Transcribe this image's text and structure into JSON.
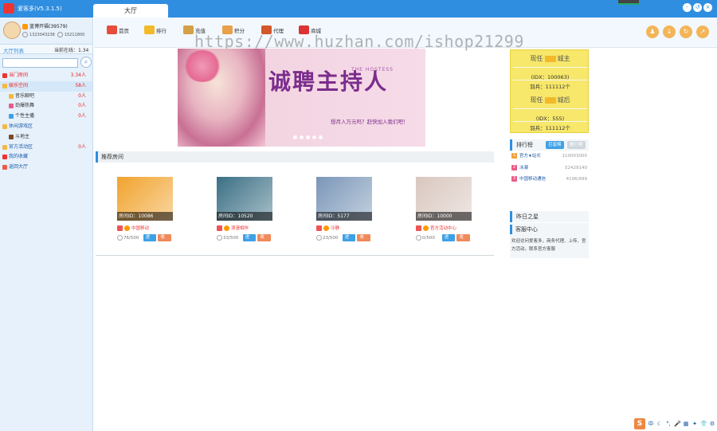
{
  "window": {
    "title": "爱客多(V5.3.1.5)",
    "tab": "大厅",
    "controls": [
      "-",
      "↺",
      "×"
    ]
  },
  "profile": {
    "name": "蓝博开福(39579)",
    "id_text": "1323043238",
    "coins": "15211800"
  },
  "hall": {
    "title": "大厅列表",
    "online_label": "当前在线：",
    "online_value": "1.34",
    "search_placeholder": ""
  },
  "tree": [
    {
      "label": "当门房间",
      "count": "3.34人",
      "style": "red",
      "indent": 4,
      "color": "#e33"
    },
    {
      "label": "娱乐空间",
      "count": "58人",
      "style": "red",
      "indent": 4,
      "color": "#f3b942"
    },
    {
      "label": "音乐聊吧",
      "count": "0人",
      "style": "",
      "indent": 12,
      "color": "#f3b942"
    },
    {
      "label": "劲爆热舞",
      "count": "0人",
      "style": "",
      "indent": 12,
      "color": "#e95c88"
    },
    {
      "label": "个性主播",
      "count": "0人",
      "style": "",
      "indent": 12,
      "color": "#3ea0e6"
    },
    {
      "label": "休闲游戏区",
      "count": "",
      "style": "main",
      "indent": 4,
      "color": "#f3b942"
    },
    {
      "label": "斗地主",
      "count": "",
      "style": "",
      "indent": 12,
      "color": "#7a4a2a"
    },
    {
      "label": "官方活动区",
      "count": "0人",
      "style": "main",
      "indent": 4,
      "color": "#f3b942"
    },
    {
      "label": "我的收藏",
      "count": "",
      "style": "main",
      "indent": 4,
      "color": "#e33"
    },
    {
      "label": "返回大厅",
      "count": "",
      "style": "main",
      "indent": 4,
      "color": "#e95c4a"
    }
  ],
  "nav": [
    {
      "label": "首页",
      "icon": "home-icon",
      "color": "#e74c3c"
    },
    {
      "label": "排行",
      "icon": "crown-icon",
      "color": "#f2b92a"
    },
    {
      "label": "充值",
      "icon": "coin-icon",
      "color": "#d4a048"
    },
    {
      "label": "积分",
      "icon": "gift-icon",
      "color": "#e8a04a"
    },
    {
      "label": "代理",
      "icon": "shop-icon",
      "color": "#d4562b"
    },
    {
      "label": "商城",
      "icon": "wifi-icon",
      "color": "#d33"
    }
  ],
  "nav_round_buttons": [
    "user-icon",
    "download-icon",
    "refresh-icon",
    "share-icon"
  ],
  "watermark": "https://www.huzhan.com/ishop21299",
  "banner": {
    "headline": "诚聘主持人",
    "english": "THE HOSTESS",
    "subline": "想月入万元吗？赶快加入我们吧！",
    "slides": 5
  },
  "recommended": {
    "title": "推荐房间",
    "enter_label": "进入",
    "collect_label": "收藏",
    "rooms": [
      {
        "room_id": "房间ID：10086",
        "name": "中国移动",
        "capacity": "76/500",
        "thumb": "#f1a32d"
      },
      {
        "room_id": "房间ID：10520",
        "name": "浪漫相伴",
        "capacity": "33/500",
        "thumb": "#3a6f84"
      },
      {
        "room_id": "房间ID：5177",
        "name": "冷静",
        "capacity": "23/500",
        "thumb": "#7a96b8"
      },
      {
        "room_id": "房间ID：10000",
        "name": "官方活动中心",
        "capacity": "0/500",
        "thumb": "#d9c7bf"
      }
    ]
  },
  "vip": {
    "blocks": [
      {
        "title_left": "现任",
        "title_right": "城主",
        "id_text": "(IDX：100063)",
        "count_text": "羽兵：111112个"
      },
      {
        "title_left": "现任",
        "title_right": "城后",
        "id_text": "(IDX：555)",
        "count_text": "羽兵：111112个"
      }
    ]
  },
  "ranking": {
    "title": "排行榜",
    "tab_active": "巨富榜",
    "tab_inactive": "魅力榜",
    "rows": [
      {
        "no": "1",
        "name": "官方★站长",
        "value": "110003000",
        "color": "#f2a33c"
      },
      {
        "no": "2",
        "name": "冰凝",
        "value": "52429140",
        "color": "#e95c88"
      },
      {
        "no": "3",
        "name": "中国移动通信",
        "value": "4196/999",
        "color": "#e95c88"
      }
    ]
  },
  "star": {
    "title": "昨日之星"
  },
  "help": {
    "title": "客服中心",
    "body": "欢迎访问爱客多，商务代理、上传、官方活动，联系官方客服"
  },
  "tray": [
    "中",
    "☾",
    "°,",
    "🎤",
    "▦",
    "✦",
    "👕",
    "⚙"
  ]
}
